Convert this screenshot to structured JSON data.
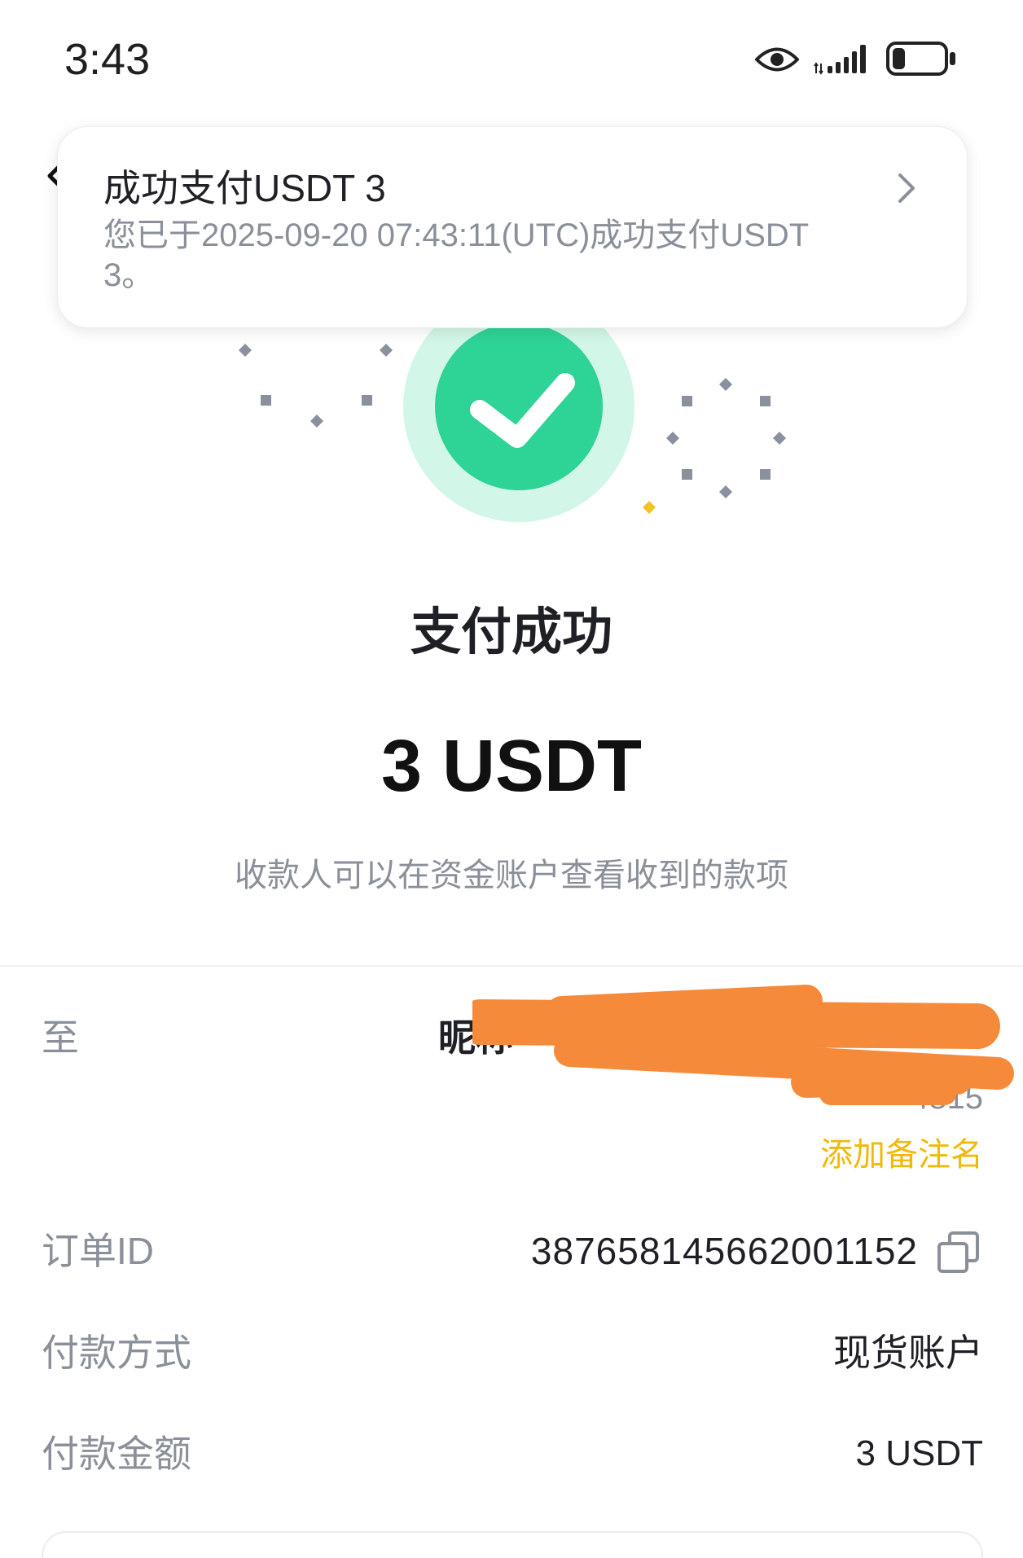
{
  "status_bar": {
    "time": "3:43",
    "icons": {
      "eye": "eye-icon",
      "signal": "signal-icon",
      "battery": "battery-icon"
    },
    "battery_level": 0.25
  },
  "notification": {
    "title": "成功支付USDT 3",
    "message_lines": [
      "您已于2025-09-20 07:43:11(UTC)成功支付USDT",
      "3。"
    ],
    "chevron": "chevron-right-icon"
  },
  "result": {
    "icon": "check-circle-icon",
    "status": "支付成功",
    "amount": "3 USDT",
    "note": "收款人可以在资金账户查看收到的款项"
  },
  "details": {
    "recipient": {
      "label": "至",
      "nickname": "昵称",
      "uid": "4815",
      "add_remark": "添加备注名"
    },
    "rows": [
      {
        "label": "订单ID",
        "value": "387658145662001152",
        "icon": "copy-icon"
      },
      {
        "label": "付款方式",
        "value": "现货账户"
      },
      {
        "label": "付款金额",
        "value": "3 USDT"
      }
    ]
  },
  "colors": {
    "accent_green": "#2ed396",
    "accent_mint": "#d2f6e7",
    "highlight": "#f0b90b",
    "muted": "#8a8f99",
    "confetti": "#8a909c",
    "redaction": "#f58a3a"
  }
}
